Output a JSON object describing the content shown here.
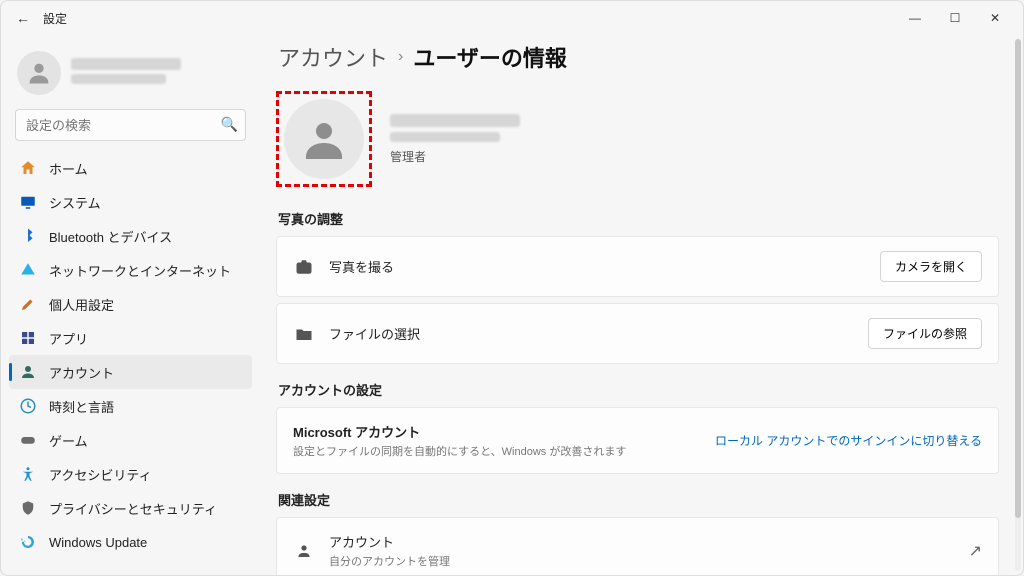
{
  "titlebar": {
    "app_title": "設定"
  },
  "sidebar": {
    "search_placeholder": "設定の検索",
    "items": [
      {
        "label": "ホーム"
      },
      {
        "label": "システム"
      },
      {
        "label": "Bluetooth とデバイス"
      },
      {
        "label": "ネットワークとインターネット"
      },
      {
        "label": "個人用設定"
      },
      {
        "label": "アプリ"
      },
      {
        "label": "アカウント"
      },
      {
        "label": "時刻と言語"
      },
      {
        "label": "ゲーム"
      },
      {
        "label": "アクセシビリティ"
      },
      {
        "label": "プライバシーとセキュリティ"
      },
      {
        "label": "Windows Update"
      }
    ]
  },
  "breadcrumb": {
    "parent": "アカウント",
    "current": "ユーザーの情報"
  },
  "user": {
    "role": "管理者"
  },
  "sections": {
    "photo": {
      "title": "写真の調整",
      "take_photo": "写真を撮る",
      "open_camera_btn": "カメラを開く",
      "choose_file": "ファイルの選択",
      "browse_btn": "ファイルの参照"
    },
    "account": {
      "title": "アカウントの設定",
      "ms_account": "Microsoft アカウント",
      "ms_sub": "設定とファイルの同期を自動的にすると、Windows が改善されます",
      "switch_link": "ローカル アカウントでのサインインに切り替える"
    },
    "related": {
      "title": "関連設定",
      "accounts_label": "アカウント",
      "accounts_sub": "自分のアカウントを管理"
    }
  }
}
